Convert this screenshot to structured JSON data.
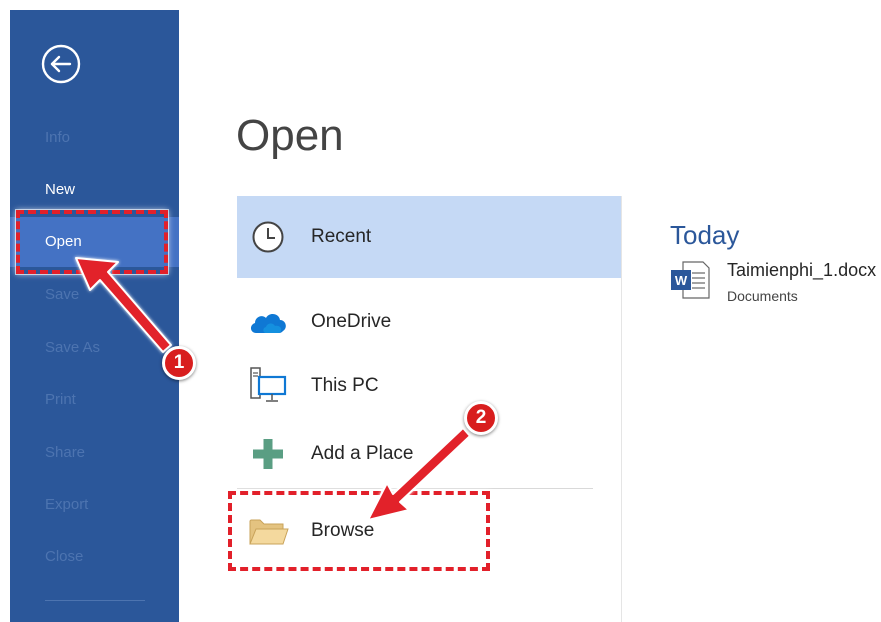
{
  "sidebar": {
    "items": [
      {
        "label": "Info",
        "state": "disabled"
      },
      {
        "label": "New",
        "state": "normal"
      },
      {
        "label": "Open",
        "state": "active"
      },
      {
        "label": "Save",
        "state": "disabled"
      },
      {
        "label": "Save As",
        "state": "disabled"
      },
      {
        "label": "Print",
        "state": "disabled"
      },
      {
        "label": "Share",
        "state": "disabled"
      },
      {
        "label": "Export",
        "state": "disabled"
      },
      {
        "label": "Close",
        "state": "disabled"
      }
    ]
  },
  "main": {
    "title": "Open",
    "locations": [
      {
        "label": "Recent",
        "icon": "clock-icon",
        "selected": true
      },
      {
        "label": "OneDrive",
        "icon": "cloud-icon",
        "selected": false
      },
      {
        "label": "This PC",
        "icon": "computer-icon",
        "selected": false
      },
      {
        "label": "Add a Place",
        "icon": "plus-icon",
        "selected": false
      },
      {
        "label": "Browse",
        "icon": "folder-icon",
        "selected": false
      }
    ],
    "recent": {
      "group_label": "Today",
      "files": [
        {
          "name": "Taimienphi_1.docx",
          "path": "Documents",
          "icon": "word-document-icon"
        }
      ]
    }
  },
  "annotations": {
    "step1": "1",
    "step2": "2"
  },
  "colors": {
    "sidebar_bg": "#2b579a",
    "sidebar_active": "#4472c4",
    "selected_location": "#c5d9f5",
    "accent_text": "#2b579a",
    "annotation_red": "#e2202a"
  }
}
